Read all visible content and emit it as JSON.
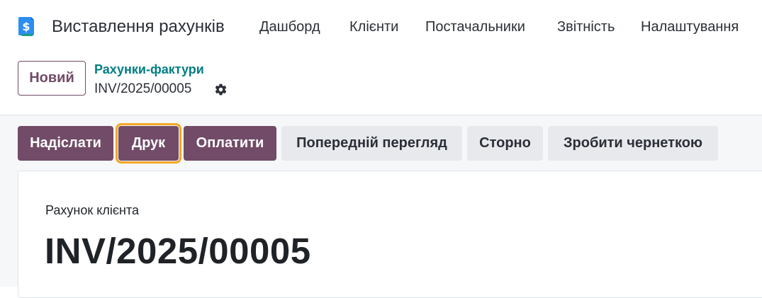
{
  "app": {
    "title": "Виставлення рахунків",
    "logo_icon": "billing-dollar-icon",
    "colors": {
      "brand": "#714b67",
      "accent_link": "#017e84",
      "logo_blue": "#2b8ef2",
      "highlight": "#f5a623"
    }
  },
  "nav": {
    "items": [
      {
        "label": "Дашборд"
      },
      {
        "label": "Клієнти"
      },
      {
        "label": "Постачальники"
      },
      {
        "label": "Звітність"
      },
      {
        "label": "Налаштування"
      }
    ]
  },
  "control_panel": {
    "new_label": "Новий",
    "breadcrumb_parent": "Рахунки-фактури",
    "breadcrumb_current": "INV/2025/00005",
    "settings_icon": "gear-icon"
  },
  "statusbar": {
    "buttons": [
      {
        "label": "Надіслати",
        "style": "primary"
      },
      {
        "label": "Друк",
        "style": "primary"
      },
      {
        "label": "Оплатити",
        "style": "primary"
      },
      {
        "label": "Попередній перегляд",
        "style": "secondary"
      },
      {
        "label": "Сторно",
        "style": "secondary"
      },
      {
        "label": "Зробити чернеткою",
        "style": "secondary"
      }
    ]
  },
  "form": {
    "document_type": "Рахунок клієнта",
    "document_number": "INV/2025/00005"
  }
}
